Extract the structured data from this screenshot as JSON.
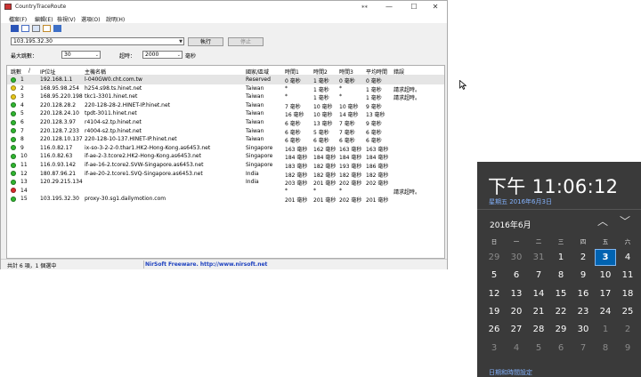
{
  "window": {
    "title": "CountryTraceRoute",
    "pin_glyph": "⁎⁎",
    "minimize": "—",
    "maximize": "☐",
    "close": "✕"
  },
  "menu": [
    "檔案(F)",
    "編輯(E)",
    "檢視(V)",
    "選項(O)",
    "說明(H)"
  ],
  "toolbar_icons": [
    "save-icon",
    "copy-icon",
    "html-report-icon",
    "properties-icon",
    "exit-icon"
  ],
  "form": {
    "host_value": "103.195.32.30",
    "run_label": "執行",
    "stop_label": "停止",
    "max_hops_label": "最大跳數：",
    "max_hops_value": "30",
    "timeout_label": "超時：",
    "timeout_value": "2000",
    "timeout_unit": "毫秒"
  },
  "table": {
    "headers": [
      "跳數",
      "/",
      "IP位址",
      "主機名稱",
      "國家/區域",
      "時間1",
      "時間2",
      "時間3",
      "平均時間",
      "錯誤"
    ],
    "rows": [
      {
        "status": "green",
        "hop": "1",
        "ip": "192.168.1.1",
        "host": "l-040GW0.cht.com.tw",
        "country": "Reserved",
        "t1": "0 毫秒",
        "t2": "1 毫秒",
        "t3": "0 毫秒",
        "avg": "0 毫秒",
        "err": "",
        "selected": true
      },
      {
        "status": "yellow",
        "hop": "2",
        "ip": "168.95.98.254",
        "host": "h254.s98.ts.hinet.net",
        "country": "Taiwan",
        "t1": "*",
        "t2": "1 毫秒",
        "t3": "*",
        "avg": "1 毫秒",
        "err": "請求超時。",
        "selected": false
      },
      {
        "status": "yellow",
        "hop": "3",
        "ip": "168.95.220.198",
        "host": "tkc1-3301.hinet.net",
        "country": "Taiwan",
        "t1": "*",
        "t2": "1 毫秒",
        "t3": "*",
        "avg": "1 毫秒",
        "err": "請求超時。",
        "selected": false
      },
      {
        "status": "green",
        "hop": "4",
        "ip": "220.128.28.2",
        "host": "220-128-28-2.HINET-IP.hinet.net",
        "country": "Taiwan",
        "t1": "7 毫秒",
        "t2": "10 毫秒",
        "t3": "10 毫秒",
        "avg": "9 毫秒",
        "err": "",
        "selected": false
      },
      {
        "status": "green",
        "hop": "5",
        "ip": "220.128.24.10",
        "host": "tpdt-3011.hinet.net",
        "country": "Taiwan",
        "t1": "16 毫秒",
        "t2": "10 毫秒",
        "t3": "14 毫秒",
        "avg": "13 毫秒",
        "err": "",
        "selected": false
      },
      {
        "status": "green",
        "hop": "6",
        "ip": "220.128.3.97",
        "host": "r4104-s2.tp.hinet.net",
        "country": "Taiwan",
        "t1": "6 毫秒",
        "t2": "13 毫秒",
        "t3": "7 毫秒",
        "avg": "9 毫秒",
        "err": "",
        "selected": false
      },
      {
        "status": "green",
        "hop": "7",
        "ip": "220.128.7.233",
        "host": "r4004-s2.tp.hinet.net",
        "country": "Taiwan",
        "t1": "6 毫秒",
        "t2": "5 毫秒",
        "t3": "7 毫秒",
        "avg": "6 毫秒",
        "err": "",
        "selected": false
      },
      {
        "status": "green",
        "hop": "8",
        "ip": "220.128.10.137",
        "host": "220-128-10-137.HINET-IP.hinet.net",
        "country": "Taiwan",
        "t1": "6 毫秒",
        "t2": "6 毫秒",
        "t3": "6 毫秒",
        "avg": "6 毫秒",
        "err": "",
        "selected": false
      },
      {
        "status": "green",
        "hop": "9",
        "ip": "116.0.82.17",
        "host": "ix-so-3-2-2-0.thar1.HK2-Hong-Kong.as6453.net",
        "country": "Singapore",
        "t1": "163 毫秒",
        "t2": "162 毫秒",
        "t3": "163 毫秒",
        "avg": "163 毫秒",
        "err": "",
        "selected": false
      },
      {
        "status": "green",
        "hop": "10",
        "ip": "116.0.82.63",
        "host": "if-ae-2-3.tcore2.HK2-Hong-Kong.as6453.net",
        "country": "Singapore",
        "t1": "184 毫秒",
        "t2": "184 毫秒",
        "t3": "184 毫秒",
        "avg": "184 毫秒",
        "err": "",
        "selected": false
      },
      {
        "status": "green",
        "hop": "11",
        "ip": "116.0.93.142",
        "host": "if-ae-16-2.tcore2.SVW-Singapore.as6453.net",
        "country": "Singapore",
        "t1": "183 毫秒",
        "t2": "182 毫秒",
        "t3": "193 毫秒",
        "avg": "186 毫秒",
        "err": "",
        "selected": false
      },
      {
        "status": "green",
        "hop": "12",
        "ip": "180.87.96.21",
        "host": "if-ae-20-2.tcore1.SVQ-Singapore.as6453.net",
        "country": "India",
        "t1": "182 毫秒",
        "t2": "182 毫秒",
        "t3": "182 毫秒",
        "avg": "182 毫秒",
        "err": "",
        "selected": false
      },
      {
        "status": "green",
        "hop": "13",
        "ip": "120.29.215.134",
        "host": "",
        "country": "India",
        "t1": "203 毫秒",
        "t2": "201 毫秒",
        "t3": "202 毫秒",
        "avg": "202 毫秒",
        "err": "",
        "selected": false
      },
      {
        "status": "red",
        "hop": "14",
        "ip": "",
        "host": "",
        "country": "",
        "t1": "*",
        "t2": "*",
        "t3": "*",
        "avg": "",
        "err": "請求超時。",
        "selected": false
      },
      {
        "status": "green",
        "hop": "15",
        "ip": "103.195.32.30",
        "host": "proxy-30.sg1.dailymotion.com",
        "country": "",
        "t1": "201 毫秒",
        "t2": "201 毫秒",
        "t3": "202 毫秒",
        "avg": "201 毫秒",
        "err": "",
        "selected": false
      }
    ]
  },
  "statusbar": {
    "left": "共計 6 項，1 個選中",
    "right": "NirSoft Freeware.  http://www.nirsoft.net"
  },
  "clock_flyout": {
    "time": "下午 11:06:12",
    "date_link": "星期五 2016年6月3日",
    "month_label": "2016年6月",
    "prev": "︿",
    "next": "﹀",
    "weekdays": [
      "日",
      "一",
      "二",
      "三",
      "四",
      "五",
      "六"
    ],
    "days": [
      [
        "29",
        "30",
        "31",
        "1",
        "2",
        "3",
        "4"
      ],
      [
        "5",
        "6",
        "7",
        "8",
        "9",
        "10",
        "11"
      ],
      [
        "12",
        "13",
        "14",
        "15",
        "16",
        "17",
        "18"
      ],
      [
        "19",
        "20",
        "21",
        "22",
        "23",
        "24",
        "25"
      ],
      [
        "26",
        "27",
        "28",
        "29",
        "30",
        "1",
        "2"
      ],
      [
        "3",
        "4",
        "5",
        "6",
        "7",
        "8",
        "9"
      ]
    ],
    "today": "3",
    "settings_link": "日期和時間設定"
  },
  "colors": {
    "status_green": "#2fb52f",
    "status_yellow": "#e6c619",
    "status_red": "#d92b2b",
    "flyout_bg": "#3a3a3a",
    "accent_blue": "#0063b1"
  }
}
